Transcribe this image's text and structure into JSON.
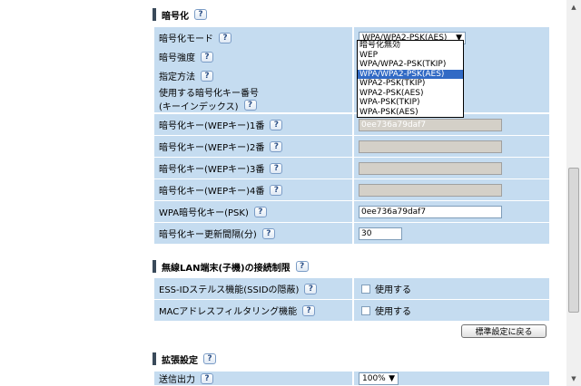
{
  "help_glyph": "?",
  "encryption": {
    "title": "暗号化",
    "rows": {
      "mode": {
        "label": "暗号化モード",
        "selected": "WPA/WPA2-PSK(AES)"
      },
      "strength": {
        "label": "暗号強度"
      },
      "method": {
        "label": "指定方法"
      },
      "key_index": {
        "label_line1": "使用する暗号化キー番号",
        "label_line2": "(キーインデックス)"
      },
      "wep1": {
        "label": "暗号化キー(WEPキー)1番",
        "value": "0ee736a79daf7"
      },
      "wep2": {
        "label": "暗号化キー(WEPキー)2番",
        "value": ""
      },
      "wep3": {
        "label": "暗号化キー(WEPキー)3番",
        "value": ""
      },
      "wep4": {
        "label": "暗号化キー(WEPキー)4番",
        "value": ""
      },
      "psk": {
        "label": "WPA暗号化キー(PSK)",
        "value": "0ee736a79daf7"
      },
      "interval": {
        "label": "暗号化キー更新間隔(分)",
        "value": "30"
      }
    },
    "dropdown_options": [
      "暗号化無効",
      "WEP",
      "WPA/WPA2-PSK(TKIP)",
      "WPA/WPA2-PSK(AES)",
      "WPA2-PSK(TKIP)",
      "WPA2-PSK(AES)",
      "WPA-PSK(TKIP)",
      "WPA-PSK(AES)"
    ],
    "dropdown_highlighted": "WPA/WPA2-PSK(AES)"
  },
  "access": {
    "title": "無線LAN端末(子機)の接続制限",
    "rows": {
      "stealth": {
        "label": "ESS-IDステルス機能(SSIDの隠蔽)",
        "checkbox_label": "使用する"
      },
      "mac": {
        "label": "MACアドレスフィルタリング機能",
        "checkbox_label": "使用する"
      }
    },
    "reset_button": "標準設定に戻る"
  },
  "extended": {
    "title": "拡張設定",
    "rows": {
      "tx_power": {
        "label": "送信出力",
        "selected": "100%"
      }
    }
  },
  "icons": {
    "help": "help-icon",
    "dropdown_arrow": "chevron-down-icon",
    "scroll_up": "scroll-up-arrow-icon",
    "scroll_down": "scroll-down-arrow-icon"
  },
  "colors": {
    "row_bg": "#c5dcf0",
    "highlight": "#316ac5",
    "help_border": "#7a9cc6"
  }
}
